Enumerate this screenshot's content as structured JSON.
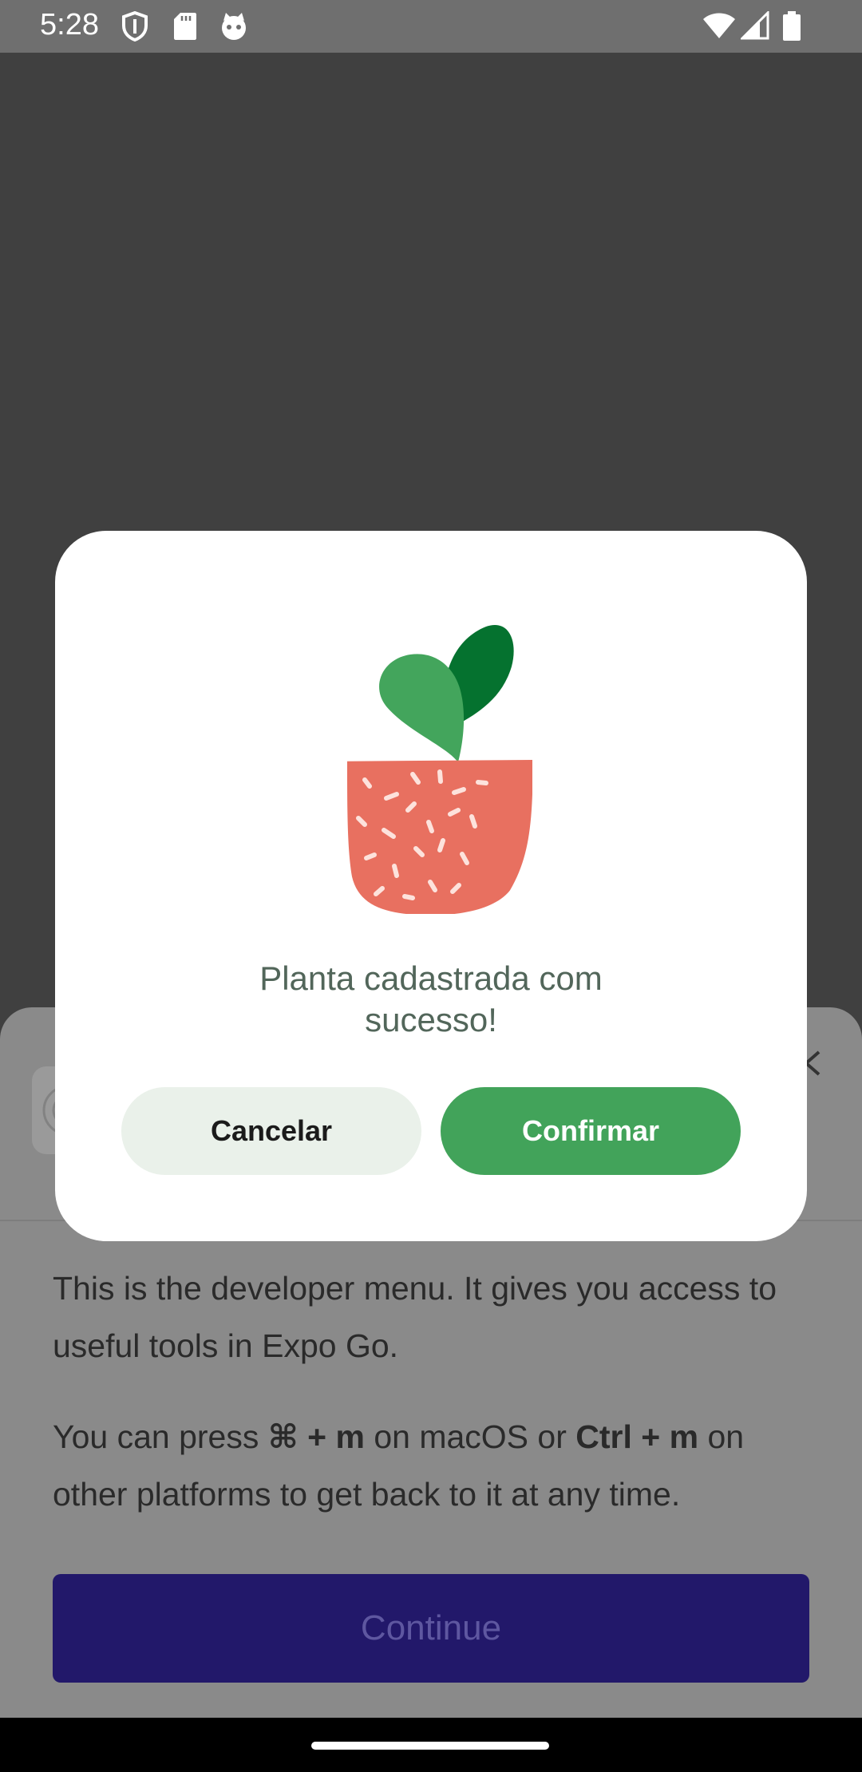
{
  "status_bar": {
    "time": "5:28"
  },
  "dev_menu": {
    "intro": "This is the developer menu. It gives you access to useful tools in Expo Go.",
    "shortcut_prefix": "You can press ",
    "shortcut_mac": "⌘ + m",
    "shortcut_mid": " on macOS or ",
    "shortcut_other": "Ctrl + m",
    "shortcut_suffix": " on other platforms to get back to it at any time.",
    "continue_label": "Continue"
  },
  "modal": {
    "message": "Planta cadastrada com sucesso!",
    "cancel_label": "Cancelar",
    "confirm_label": "Confirmar"
  },
  "colors": {
    "overlay": "#404040",
    "confirm": "#42a35a",
    "cancel_bg": "#eaf1ea",
    "message_text": "#52665a",
    "pot": "#e87060",
    "leaf_light": "#43a55c",
    "leaf_dark": "#05722f",
    "continue_bg": "#22186a"
  }
}
